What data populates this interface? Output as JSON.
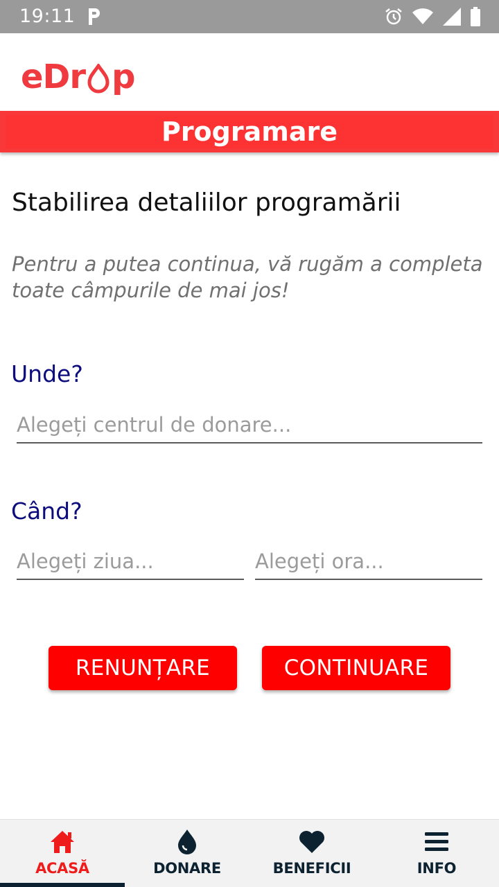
{
  "status_bar": {
    "time": "19:11"
  },
  "header": {
    "logo_pre": "eDr",
    "logo_post": "p"
  },
  "banner": {
    "title": "Programare"
  },
  "content": {
    "section_title": "Stabilirea detaliilor programării",
    "instructions": "Pentru a putea continua, vă rugăm a completa toate câmpurile de mai jos!",
    "where_label": "Unde?",
    "center_placeholder": "Alegeți centrul de donare...",
    "when_label": "Când?",
    "day_placeholder": "Alegeți ziua...",
    "hour_placeholder": "Alegeți ora..."
  },
  "buttons": {
    "cancel": "RENUNȚARE",
    "continue": "CONTINUARE"
  },
  "nav": {
    "items": [
      {
        "label": "ACASĂ",
        "icon": "home-icon",
        "active": true
      },
      {
        "label": "DONARE",
        "icon": "drop-icon",
        "active": false
      },
      {
        "label": "BENEFICII",
        "icon": "heart-icon",
        "active": false
      },
      {
        "label": "INFO",
        "icon": "menu-icon",
        "active": false
      }
    ]
  },
  "colors": {
    "brand_red": "#ff0000",
    "banner_red": "#fd3232",
    "label_navy": "#0c0c7c",
    "nav_dark": "#0d2230"
  }
}
